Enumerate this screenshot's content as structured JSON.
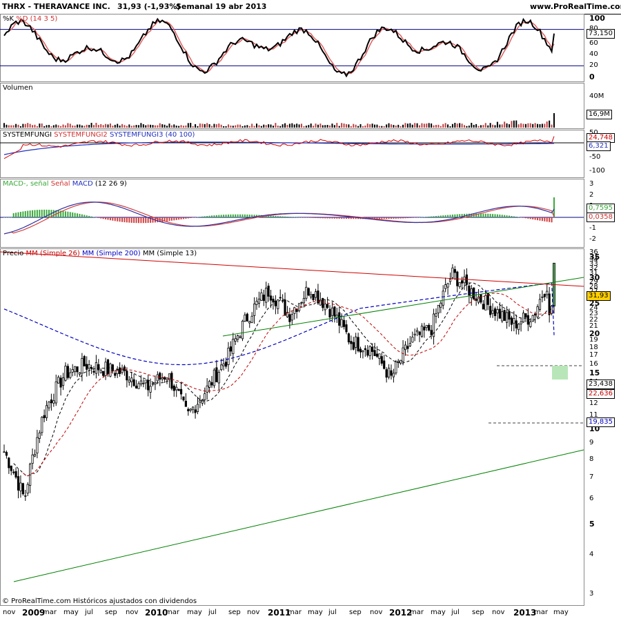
{
  "header": {
    "symbol_title": "THRX - THERAVANCE INC.",
    "quote": "31,93 (-1,93%)",
    "period": "Semanal  19 abr 2013",
    "site": "www.ProRealTime.com"
  },
  "panels": {
    "stoch": {
      "title_a": "%K",
      "title_b": "%D",
      "title_c": "(14 3 5)",
      "ticks": [
        "100",
        "80",
        "60",
        "40",
        "20",
        "0"
      ],
      "tag": "73,150"
    },
    "volume": {
      "title": "Volumen",
      "ticks": [
        "40M"
      ],
      "tag": "16,9M"
    },
    "system": {
      "title_a": "SYSTEMFUNGI",
      "title_b": "SYSTEMFUNGI2",
      "title_c": "SYSTEMFUNGI3",
      "title_d": "(40 100)",
      "ticks": [
        "50",
        "-50",
        "-100"
      ],
      "tag_a": "24,748",
      "tag_b": "6,321"
    },
    "macd": {
      "title_a": "MACD-, señal",
      "title_b": "Señal",
      "title_c": "MACD",
      "title_d": "(12 26 9)",
      "ticks": [
        "3",
        "2",
        "1",
        "0",
        "-1",
        "-2"
      ],
      "tag_a": "0,7595",
      "tag_b": "0,0358"
    },
    "price": {
      "title_a": "Precio",
      "title_b": "MM",
      "title_c": "(Simple 26)",
      "title_d": "MM",
      "title_e": "(Simple 200)",
      "title_f": "MM",
      "title_g": "(Simple 13)",
      "ticks": [
        "36",
        "35",
        "34",
        "33",
        "32",
        "31",
        "30",
        "29",
        "28",
        "27",
        "26",
        "25",
        "24",
        "23",
        "22",
        "21",
        "20",
        "19",
        "18",
        "17",
        "16",
        "15",
        "14",
        "13",
        "12",
        "11",
        "10",
        "9",
        "8",
        "7",
        "6",
        "5",
        "4",
        "3"
      ],
      "tag_last": "31,93",
      "tag_ma13": "23,438",
      "tag_ma26": "22,636",
      "tag_ma200": "19,835",
      "footer": "© ProRealTime.com  Históricos ajustados con dividendos"
    }
  },
  "x_axis": {
    "labels": [
      "nov",
      "2009",
      "mar",
      "may",
      "jul",
      "sep",
      "nov",
      "2010",
      "mar",
      "may",
      "jul",
      "sep",
      "nov",
      "2011",
      "mar",
      "may",
      "jul",
      "sep",
      "nov",
      "2012",
      "mar",
      "may",
      "jul",
      "sep",
      "nov",
      "2013",
      "mar",
      "may"
    ]
  },
  "colors": {
    "up": "#000000",
    "down": "#000000",
    "ma26": "#c00000",
    "ma200": "#0000c0",
    "ma13": "#000000",
    "channel": "#008000",
    "resistance": "#d00000",
    "stoch_k": "#000000",
    "stoch_d": "#e06060",
    "macd_hist_pos": "#3aa83a",
    "macd_hist_neg": "#d04040",
    "macd_line": "#3030a0",
    "signal_line": "#d04040"
  },
  "chart_data": {
    "type": "candlestick",
    "weekly_close_samples": {
      "dates": [
        "2008-11",
        "2009-01",
        "2009-03",
        "2009-05",
        "2009-07",
        "2009-09",
        "2009-11",
        "2010-01",
        "2010-03",
        "2010-05",
        "2010-07",
        "2010-09",
        "2010-11",
        "2011-01",
        "2011-03",
        "2011-05",
        "2011-07",
        "2011-09",
        "2011-11",
        "2012-01",
        "2012-03",
        "2012-05",
        "2012-07",
        "2012-09",
        "2012-11",
        "2013-01",
        "2013-03",
        "2013-04-19"
      ],
      "close": [
        8.5,
        6.0,
        11.5,
        15.0,
        16.0,
        15.5,
        15.0,
        13.5,
        15.0,
        11.0,
        13.5,
        17.0,
        23.0,
        27.5,
        23.0,
        28.0,
        24.0,
        19.0,
        18.0,
        14.5,
        19.0,
        21.0,
        31.0,
        27.0,
        24.0,
        21.5,
        23.0,
        31.93
      ]
    },
    "price_range": [
      3,
      36
    ],
    "ma200_last": 19.835,
    "ma26_last": 22.636,
    "ma13_last": 23.438,
    "last_close": 31.93,
    "stoch_last": 73.15,
    "macd_last": 0.7595,
    "signal_last": 0.0358,
    "systemfungi_last": 24.748,
    "systemfungi_b_last": 6.321,
    "volume_last": "16,9M"
  }
}
